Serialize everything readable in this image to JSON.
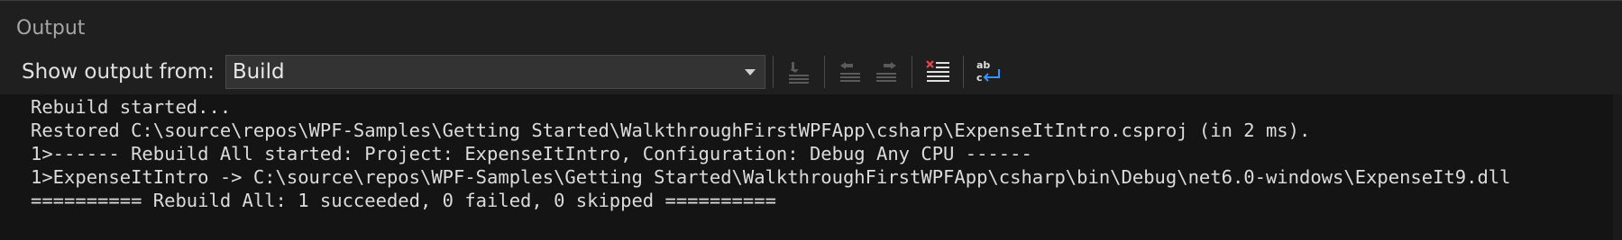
{
  "panel": {
    "title": "Output"
  },
  "toolbar": {
    "show_output_label": "Show output from:",
    "source_selected": "Build",
    "buttons": [
      {
        "name": "go-to-current-line",
        "icon": "go-to-line-icon",
        "enabled": false
      },
      {
        "name": "previous-message",
        "icon": "previous-message-icon",
        "enabled": false
      },
      {
        "name": "next-message",
        "icon": "next-message-icon",
        "enabled": false
      },
      {
        "name": "clear-all",
        "icon": "clear-all-icon",
        "enabled": true
      },
      {
        "name": "toggle-word-wrap",
        "icon": "word-wrap-icon",
        "enabled": true
      }
    ]
  },
  "log": {
    "lines": [
      "Rebuild started...",
      "Restored C:\\source\\repos\\WPF-Samples\\Getting Started\\WalkthroughFirstWPFApp\\csharp\\ExpenseItIntro.csproj (in 2 ms).",
      "1>------ Rebuild All started: Project: ExpenseItIntro, Configuration: Debug Any CPU ------",
      "1>ExpenseItIntro -> C:\\source\\repos\\WPF-Samples\\Getting Started\\WalkthroughFirstWPFApp\\csharp\\bin\\Debug\\net6.0-windows\\ExpenseIt9.dll",
      "========== Rebuild All: 1 succeeded, 0 failed, 0 skipped =========="
    ]
  },
  "colors": {
    "background": "#1f1f1f",
    "log_background": "#141414",
    "text": "#dcdcdc",
    "accent_blue": "#3794ff",
    "clear_red": "#e5484d"
  }
}
